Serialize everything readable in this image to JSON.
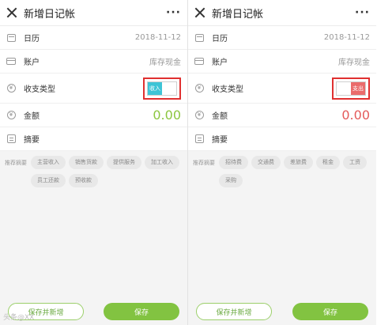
{
  "left": {
    "header": {
      "title": "新增日记帐",
      "more": "···"
    },
    "rows": {
      "date_label": "日历",
      "date_value": "2018-11-12",
      "account_label": "账户",
      "account_value": "库存现金",
      "type_label": "收支类型",
      "toggle_text": "收入",
      "amount_label": "金额",
      "amount_value": "0.00",
      "summary_label": "摘要"
    },
    "suggest_label": "推荐摘要",
    "chips": [
      "主营收入",
      "销售货款",
      "提供服务",
      "加工收入",
      "员工还款",
      "预收款"
    ],
    "buttons": {
      "save_new": "保存并新增",
      "save": "保存"
    },
    "watermark": "头条@XX"
  },
  "right": {
    "header": {
      "title": "新增日记帐",
      "more": "···"
    },
    "rows": {
      "date_label": "日历",
      "date_value": "2018-11-12",
      "account_label": "账户",
      "account_value": "库存现金",
      "type_label": "收支类型",
      "toggle_text": "支出",
      "amount_label": "金额",
      "amount_value": "0.00",
      "summary_label": "摘要"
    },
    "suggest_label": "推荐摘要",
    "chips": [
      "招待费",
      "交通费",
      "差旅费",
      "租金",
      "工资",
      "采购"
    ],
    "buttons": {
      "save_new": "保存并新增",
      "save": "保存"
    }
  },
  "colors": {
    "income_green": "#8cc63f",
    "expense_red": "#e45a5a",
    "toggle_income": "#3dc4d6",
    "toggle_expense": "#ea6b6b",
    "highlight_box": "#e03030"
  }
}
